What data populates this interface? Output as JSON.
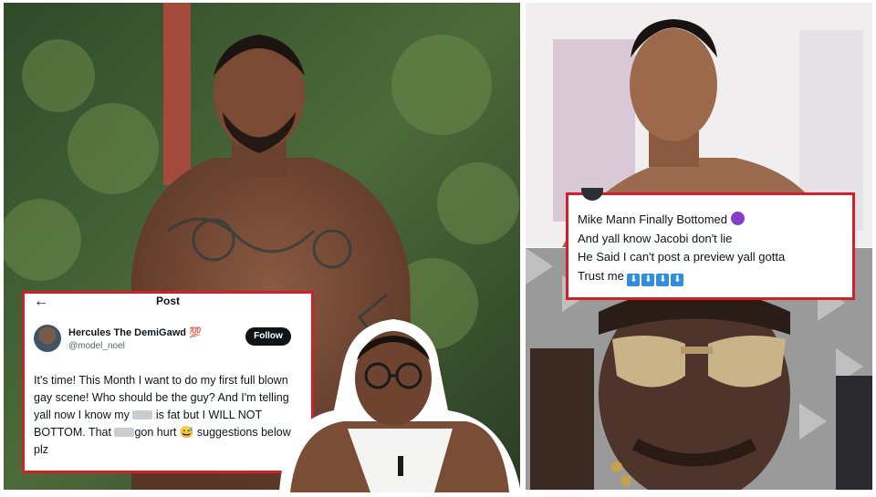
{
  "left_tweet": {
    "back_icon": "arrow-left-icon",
    "title": "Post",
    "name": "Hercules The DemiGawd",
    "name_emoji": "💯",
    "handle": "@model_noel",
    "follow_label": "Follow",
    "text_1": "It's time! This Month I want to do my first full blown gay scene! Who should be the guy? And I'm telling yall now I know my",
    "text_2": "is fat but I WILL NOT BOTTOM. That",
    "text_3": "gon hurt",
    "text_emoji": "😅",
    "text_4": "suggestions below plz"
  },
  "right_tweet": {
    "line_1": "Mike Mann Finally Bottomed",
    "line_2": "And yall know Jacobi don't lie",
    "line_3": "He Said I can't post a preview yall gotta",
    "line_4": "Trust me",
    "arrow_emoji": "⬇",
    "arrow_count": 4
  },
  "colors": {
    "card_border": "#d0202a",
    "follow_bg": "#0f1419",
    "arrow_emoji_bg": "#2e8fe0"
  }
}
